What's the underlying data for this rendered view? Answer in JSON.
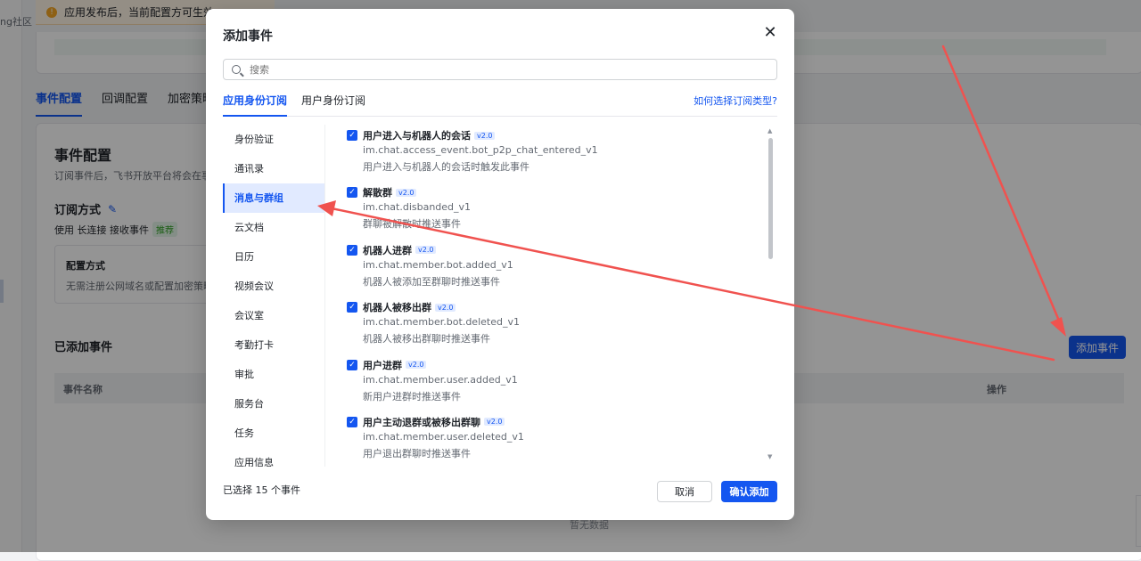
{
  "background": {
    "left_label": "ng社区",
    "notice": "应用发布后，当前配置方可生效",
    "tabs": [
      "事件配置",
      "回调配置",
      "加密策略"
    ],
    "section_title": "事件配置",
    "section_desc": "订阅事件后，飞书开放平台将会在事",
    "subscribe_mode_label": "订阅方式",
    "subscribe_mode_value": "使用 长连接 接收事件",
    "recommended_tag": "推荐",
    "config_box_title": "配置方式",
    "config_box_text": "无需注册公网域名或配置加密策略",
    "added_events_title": "已添加事件",
    "add_event_button": "添加事件",
    "table_col_name": "事件名称",
    "table_col_action": "操作",
    "empty_text": "暂无数据"
  },
  "modal": {
    "title": "添加事件",
    "search_placeholder": "搜索",
    "tabs": [
      "应用身份订阅",
      "用户身份订阅"
    ],
    "help_link": "如何选择订阅类型?",
    "categories": [
      "身份验证",
      "通讯录",
      "消息与群组",
      "云文档",
      "日历",
      "视频会议",
      "会议室",
      "考勤打卡",
      "审批",
      "服务台",
      "任务",
      "应用信息"
    ],
    "active_category": "消息与群组",
    "events": [
      {
        "name": "用户进入与机器人的会话",
        "version": "v2.0",
        "key": "im.chat.access_event.bot_p2p_chat_entered_v1",
        "desc": "用户进入与机器人的会话时触发此事件",
        "checked": true
      },
      {
        "name": "解散群",
        "version": "v2.0",
        "key": "im.chat.disbanded_v1",
        "desc": "群聊被解散时推送事件",
        "checked": true
      },
      {
        "name": "机器人进群",
        "version": "v2.0",
        "key": "im.chat.member.bot.added_v1",
        "desc": "机器人被添加至群聊时推送事件",
        "checked": true
      },
      {
        "name": "机器人被移出群",
        "version": "v2.0",
        "key": "im.chat.member.bot.deleted_v1",
        "desc": "机器人被移出群聊时推送事件",
        "checked": true
      },
      {
        "name": "用户进群",
        "version": "v2.0",
        "key": "im.chat.member.user.added_v1",
        "desc": "新用户进群时推送事件",
        "checked": true
      },
      {
        "name": "用户主动退群或被移出群聊",
        "version": "v2.0",
        "key": "im.chat.member.user.deleted_v1",
        "desc": "用户退出群聊时推送事件",
        "checked": true
      }
    ],
    "selected_count": "已选择 15 个事件",
    "cancel_label": "取消",
    "confirm_label": "确认添加"
  },
  "colors": {
    "accent": "#1456f0",
    "annotation": "#f0524f"
  },
  "icons": {
    "close": "close-icon",
    "search": "search-icon",
    "checkbox": "check-icon",
    "edit": "pencil-icon",
    "warning": "warning-icon"
  }
}
